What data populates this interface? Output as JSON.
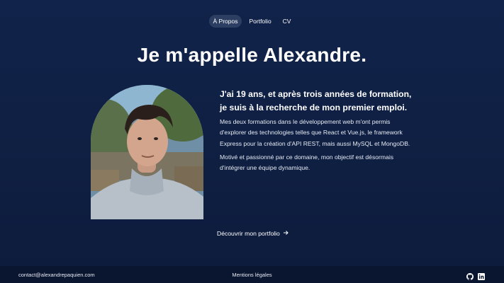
{
  "nav": {
    "items": [
      {
        "label": "À Propos",
        "active": true
      },
      {
        "label": "Portfolio",
        "active": false
      },
      {
        "label": "CV",
        "active": false
      }
    ]
  },
  "hero": {
    "title": "Je m'appelle Alexandre.",
    "lead": "J'ai 19 ans, et après trois années de formation, je suis à la recherche de mon premier emploi.",
    "paragraph_1": "Mes deux formations dans le développement web m'ont permis d'explorer des technologies telles que React et Vue.js, le framework Express pour la création d'API REST, mais aussi MySQL et MongoDB.",
    "paragraph_2": "Motivé et passionné par ce domaine, mon objectif est désormais d'intégrer une équipe dynamique.",
    "cta_label": "Découvrir mon portfolio",
    "cta_icon": "arrow-right-icon"
  },
  "footer": {
    "email": "contact@alexandrepaquien.com",
    "legal_label": "Mentions légales",
    "icons": [
      "github-icon",
      "linkedin-icon"
    ]
  },
  "colors": {
    "background": "#11234a",
    "footer_background": "#0a1530",
    "active_pill": "#2c3e61",
    "text": "#ffffff"
  }
}
